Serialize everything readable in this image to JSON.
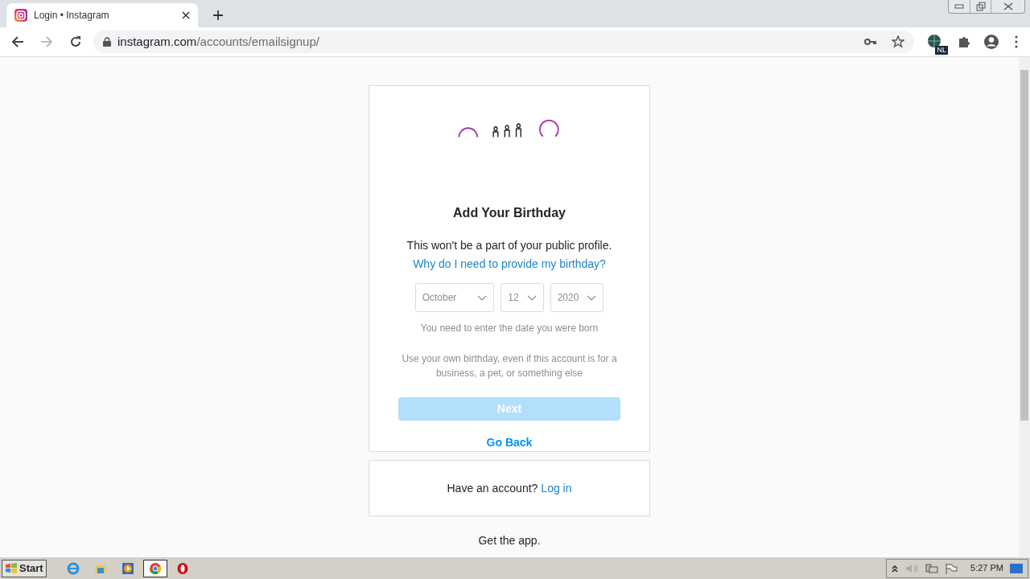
{
  "browser": {
    "tab": {
      "title": "Login • Instagram",
      "selected": true
    },
    "url": {
      "host": "instagram.com",
      "path": "/accounts/emailsignup/"
    },
    "extension_badge": "NL"
  },
  "signup": {
    "title": "Add Your Birthday",
    "subtitle": "This won't be a part of your public profile.",
    "help_link": "Why do I need to provide my birthday?",
    "selects": [
      {
        "value": "October"
      },
      {
        "value": "12"
      },
      {
        "value": "2020"
      }
    ],
    "error": "You need to enter the date you were born",
    "note": "Use your own birthday, even if this account is for a business, a pet, or something else",
    "next_button": {
      "label": "Next",
      "disabled": true
    },
    "back_link": "Go Back"
  },
  "login_box": {
    "prompt": "Have an account?",
    "link": "Log in"
  },
  "get_app": "Get the app.",
  "taskbar": {
    "start": "Start",
    "items": [
      {
        "kind": "ie",
        "active": false
      },
      {
        "kind": "folder",
        "active": false
      },
      {
        "kind": "media",
        "active": false
      },
      {
        "kind": "chrome",
        "active": true
      },
      {
        "kind": "opera",
        "active": false
      }
    ],
    "clock": "5:27 PM"
  }
}
